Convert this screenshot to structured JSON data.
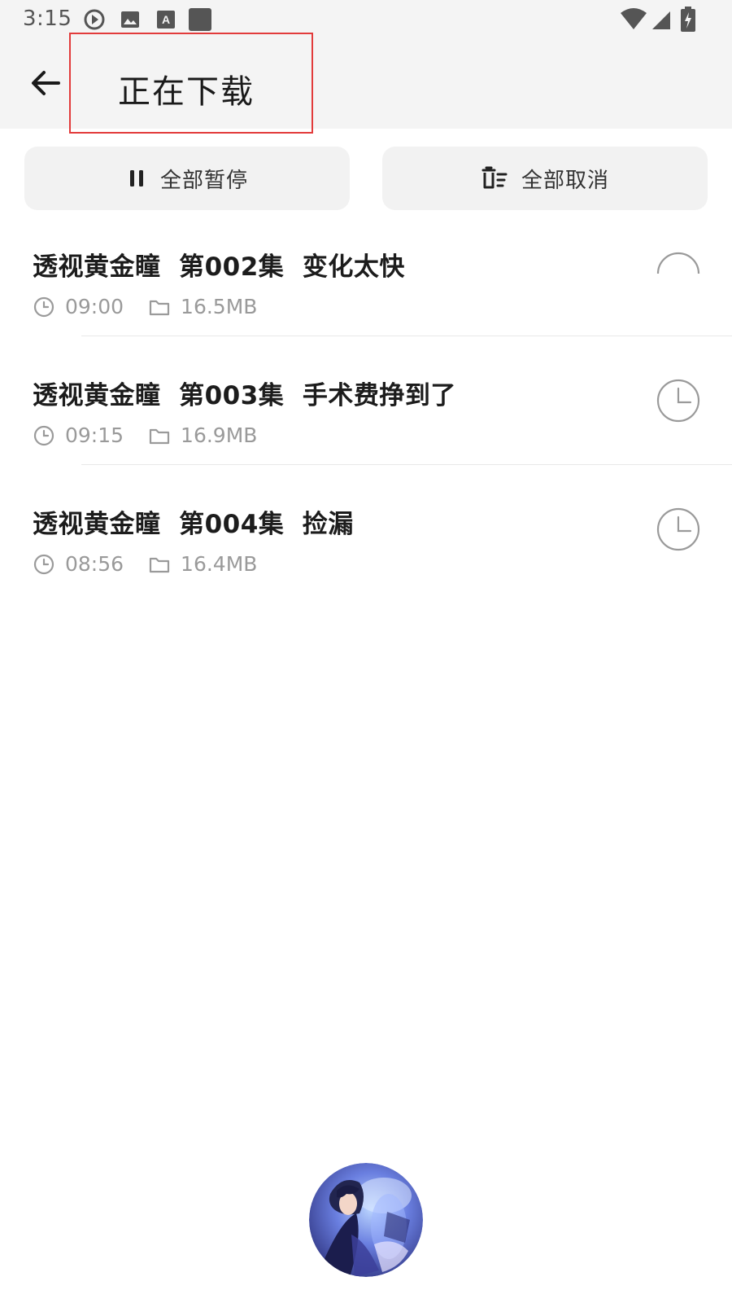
{
  "status_bar": {
    "time": "3:15",
    "icons": [
      "play-circle-icon",
      "image-icon",
      "font-a-icon",
      "square-app-icon",
      "wifi-icon",
      "signal-icon",
      "battery-charging-icon"
    ]
  },
  "app_bar": {
    "back_icon": "arrow-left-icon",
    "title": "正在下载"
  },
  "actions": {
    "pause_all": {
      "icon": "pause-icon",
      "label": "全部暂停"
    },
    "cancel_all": {
      "icon": "delete-list-icon",
      "label": "全部取消"
    }
  },
  "downloads": [
    {
      "title": "透视黄金瞳  第002集  变化太快",
      "duration": "09:00",
      "size": "16.5MB",
      "state": "downloading",
      "state_icon": "progress-arc-icon"
    },
    {
      "title": "透视黄金瞳  第003集  手术费挣到了",
      "duration": "09:15",
      "size": "16.9MB",
      "state": "waiting",
      "state_icon": "clock-icon"
    },
    {
      "title": "透视黄金瞳  第004集  捡漏",
      "duration": "08:56",
      "size": "16.4MB",
      "state": "waiting",
      "state_icon": "clock-icon"
    }
  ],
  "floating_player": {
    "cover_icon": "album-cover-image"
  },
  "colors": {
    "app_bar_bg": "#f4f4f4",
    "highlight_border": "#e23b3b",
    "title_text": "#1c1c1c",
    "meta_text": "#9a9a9a",
    "button_bg": "#f2f2f2"
  }
}
